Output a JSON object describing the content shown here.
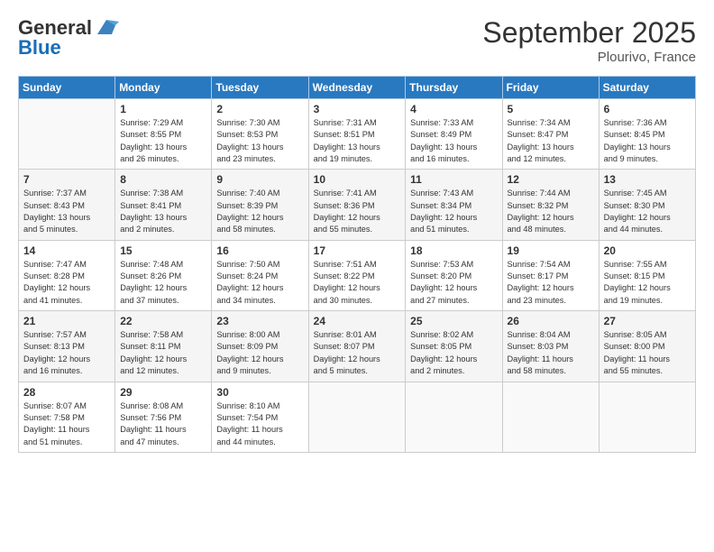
{
  "logo": {
    "line1": "General",
    "line2": "Blue"
  },
  "title": "September 2025",
  "location": "Plourivo, France",
  "days_header": [
    "Sunday",
    "Monday",
    "Tuesday",
    "Wednesday",
    "Thursday",
    "Friday",
    "Saturday"
  ],
  "weeks": [
    [
      {
        "day": "",
        "info": ""
      },
      {
        "day": "1",
        "info": "Sunrise: 7:29 AM\nSunset: 8:55 PM\nDaylight: 13 hours\nand 26 minutes."
      },
      {
        "day": "2",
        "info": "Sunrise: 7:30 AM\nSunset: 8:53 PM\nDaylight: 13 hours\nand 23 minutes."
      },
      {
        "day": "3",
        "info": "Sunrise: 7:31 AM\nSunset: 8:51 PM\nDaylight: 13 hours\nand 19 minutes."
      },
      {
        "day": "4",
        "info": "Sunrise: 7:33 AM\nSunset: 8:49 PM\nDaylight: 13 hours\nand 16 minutes."
      },
      {
        "day": "5",
        "info": "Sunrise: 7:34 AM\nSunset: 8:47 PM\nDaylight: 13 hours\nand 12 minutes."
      },
      {
        "day": "6",
        "info": "Sunrise: 7:36 AM\nSunset: 8:45 PM\nDaylight: 13 hours\nand 9 minutes."
      }
    ],
    [
      {
        "day": "7",
        "info": "Sunrise: 7:37 AM\nSunset: 8:43 PM\nDaylight: 13 hours\nand 5 minutes."
      },
      {
        "day": "8",
        "info": "Sunrise: 7:38 AM\nSunset: 8:41 PM\nDaylight: 13 hours\nand 2 minutes."
      },
      {
        "day": "9",
        "info": "Sunrise: 7:40 AM\nSunset: 8:39 PM\nDaylight: 12 hours\nand 58 minutes."
      },
      {
        "day": "10",
        "info": "Sunrise: 7:41 AM\nSunset: 8:36 PM\nDaylight: 12 hours\nand 55 minutes."
      },
      {
        "day": "11",
        "info": "Sunrise: 7:43 AM\nSunset: 8:34 PM\nDaylight: 12 hours\nand 51 minutes."
      },
      {
        "day": "12",
        "info": "Sunrise: 7:44 AM\nSunset: 8:32 PM\nDaylight: 12 hours\nand 48 minutes."
      },
      {
        "day": "13",
        "info": "Sunrise: 7:45 AM\nSunset: 8:30 PM\nDaylight: 12 hours\nand 44 minutes."
      }
    ],
    [
      {
        "day": "14",
        "info": "Sunrise: 7:47 AM\nSunset: 8:28 PM\nDaylight: 12 hours\nand 41 minutes."
      },
      {
        "day": "15",
        "info": "Sunrise: 7:48 AM\nSunset: 8:26 PM\nDaylight: 12 hours\nand 37 minutes."
      },
      {
        "day": "16",
        "info": "Sunrise: 7:50 AM\nSunset: 8:24 PM\nDaylight: 12 hours\nand 34 minutes."
      },
      {
        "day": "17",
        "info": "Sunrise: 7:51 AM\nSunset: 8:22 PM\nDaylight: 12 hours\nand 30 minutes."
      },
      {
        "day": "18",
        "info": "Sunrise: 7:53 AM\nSunset: 8:20 PM\nDaylight: 12 hours\nand 27 minutes."
      },
      {
        "day": "19",
        "info": "Sunrise: 7:54 AM\nSunset: 8:17 PM\nDaylight: 12 hours\nand 23 minutes."
      },
      {
        "day": "20",
        "info": "Sunrise: 7:55 AM\nSunset: 8:15 PM\nDaylight: 12 hours\nand 19 minutes."
      }
    ],
    [
      {
        "day": "21",
        "info": "Sunrise: 7:57 AM\nSunset: 8:13 PM\nDaylight: 12 hours\nand 16 minutes."
      },
      {
        "day": "22",
        "info": "Sunrise: 7:58 AM\nSunset: 8:11 PM\nDaylight: 12 hours\nand 12 minutes."
      },
      {
        "day": "23",
        "info": "Sunrise: 8:00 AM\nSunset: 8:09 PM\nDaylight: 12 hours\nand 9 minutes."
      },
      {
        "day": "24",
        "info": "Sunrise: 8:01 AM\nSunset: 8:07 PM\nDaylight: 12 hours\nand 5 minutes."
      },
      {
        "day": "25",
        "info": "Sunrise: 8:02 AM\nSunset: 8:05 PM\nDaylight: 12 hours\nand 2 minutes."
      },
      {
        "day": "26",
        "info": "Sunrise: 8:04 AM\nSunset: 8:03 PM\nDaylight: 11 hours\nand 58 minutes."
      },
      {
        "day": "27",
        "info": "Sunrise: 8:05 AM\nSunset: 8:00 PM\nDaylight: 11 hours\nand 55 minutes."
      }
    ],
    [
      {
        "day": "28",
        "info": "Sunrise: 8:07 AM\nSunset: 7:58 PM\nDaylight: 11 hours\nand 51 minutes."
      },
      {
        "day": "29",
        "info": "Sunrise: 8:08 AM\nSunset: 7:56 PM\nDaylight: 11 hours\nand 47 minutes."
      },
      {
        "day": "30",
        "info": "Sunrise: 8:10 AM\nSunset: 7:54 PM\nDaylight: 11 hours\nand 44 minutes."
      },
      {
        "day": "",
        "info": ""
      },
      {
        "day": "",
        "info": ""
      },
      {
        "day": "",
        "info": ""
      },
      {
        "day": "",
        "info": ""
      }
    ]
  ]
}
